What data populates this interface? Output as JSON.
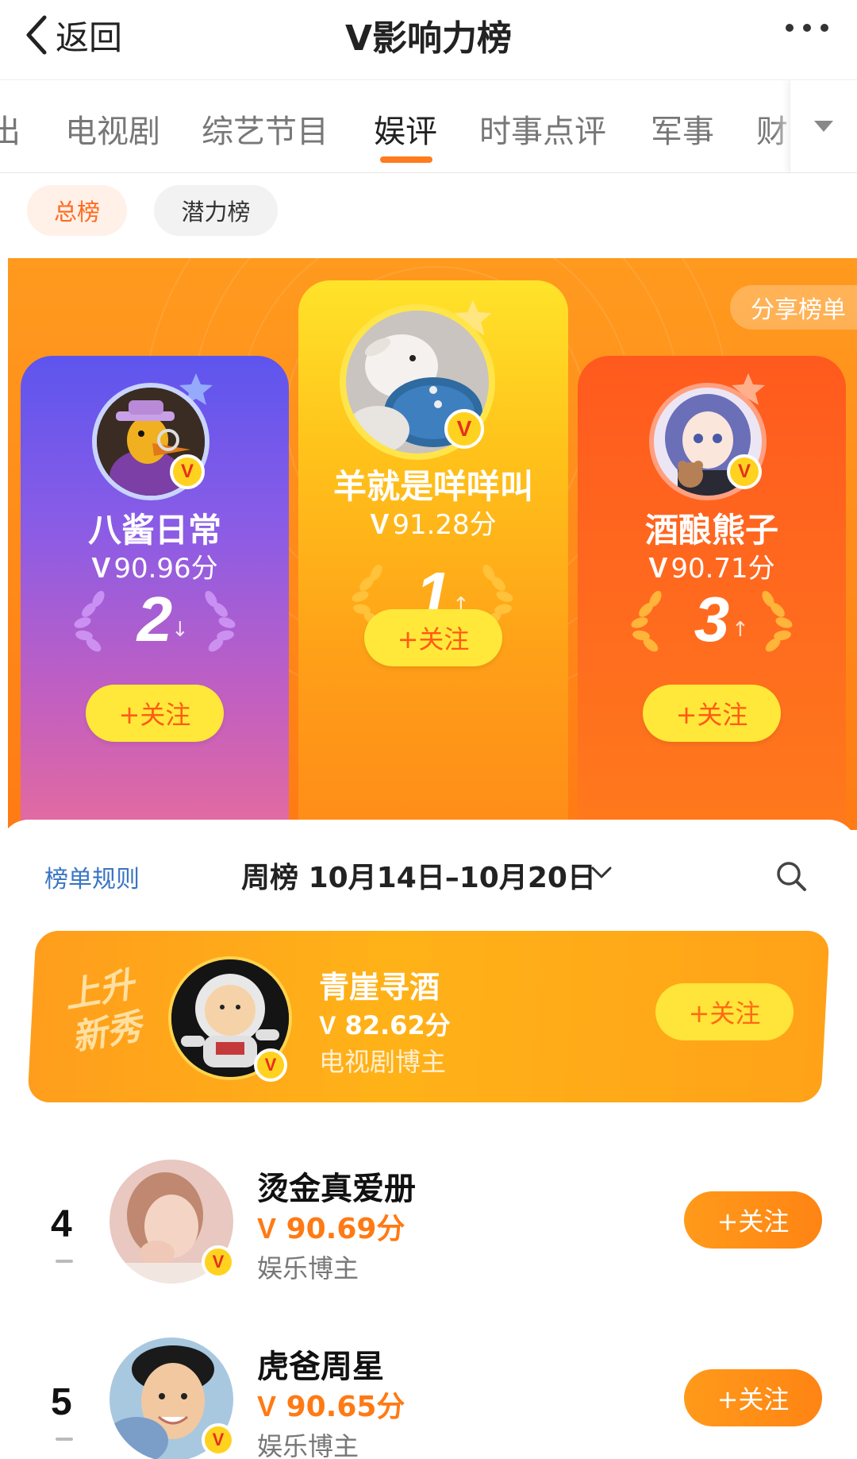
{
  "navbar": {
    "back_label": "返回",
    "title": "V影响力榜"
  },
  "tabs": {
    "items": [
      "出",
      "电视剧",
      "综艺节目",
      "娱评",
      "时事点评",
      "军事",
      "财"
    ],
    "active": "娱评"
  },
  "subtabs": {
    "items": [
      "总榜",
      "潜力榜"
    ],
    "active": "总榜"
  },
  "podium": {
    "share_label": "分享榜单",
    "follow_label": "+关注",
    "top": [
      {
        "name": "羊就是咩咩叫",
        "score_text": "91.28分",
        "rank": "1",
        "trend": "up"
      },
      {
        "name": "八酱日常",
        "score_text": "90.96分",
        "rank": "2",
        "trend": "down"
      },
      {
        "name": "酒酿熊子",
        "score_text": "90.71分",
        "rank": "3",
        "trend": "up"
      }
    ]
  },
  "list": {
    "rules_label": "榜单规则",
    "period_label": "周榜",
    "period_range": "10月14日–10月20日",
    "rising": {
      "tag_line1": "上升",
      "tag_line2": "新秀",
      "name": "青崖寻酒",
      "score_text": "82.62分",
      "category": "电视剧博主",
      "follow_label": "+关注"
    },
    "rows": [
      {
        "rank": "4",
        "name": "烫金真爱册",
        "score_text": "90.69分",
        "category": "娱乐博主",
        "follow_label": "+关注"
      },
      {
        "rank": "5",
        "name": "虎爸周星",
        "score_text": "90.65分",
        "category": "娱乐博主",
        "follow_label": "+关注"
      }
    ]
  },
  "icons": {
    "back": "chevron-left-icon",
    "more": "more-dots-icon",
    "tab_more": "triangle-down-icon",
    "verified": "v-badge-icon",
    "search": "search-icon",
    "period_toggle": "chevron-down-icon"
  },
  "colors": {
    "accent_orange": "#ff7b1c",
    "verified_yellow": "#ffd21f",
    "rules_blue": "#3a75c4"
  }
}
